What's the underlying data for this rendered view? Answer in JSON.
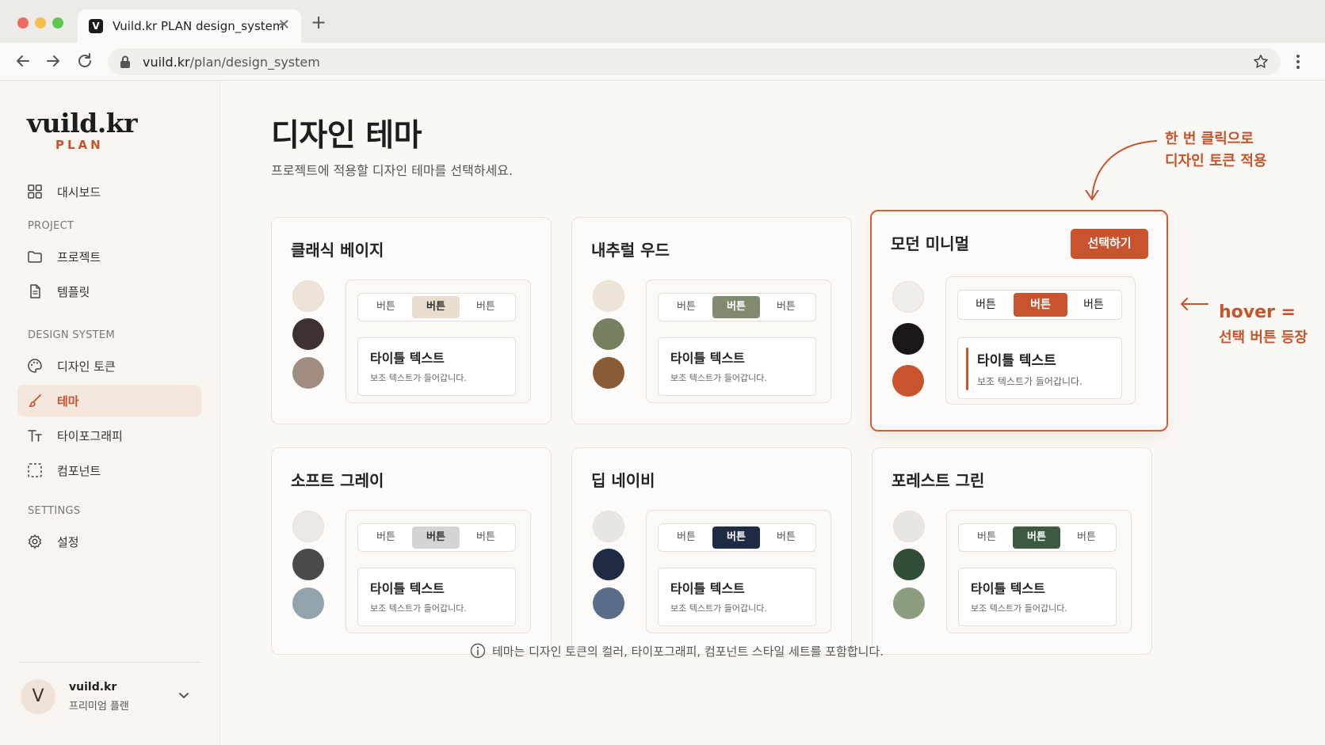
{
  "browser": {
    "tab_title": "Vuild.kr PLAN design_system",
    "favicon": "V",
    "url_domain": "vuild.kr",
    "url_path": "/plan/design_system"
  },
  "sidebar": {
    "logo": "vuild.kr",
    "logo_sub": "PLAN",
    "dashboard": "대시보드",
    "sections": {
      "project": "PROJECT",
      "design_system": "DESIGN SYSTEM",
      "settings": "SETTINGS"
    },
    "items": {
      "project": "프로젝트",
      "template": "템플릿",
      "design_token": "디자인 토큰",
      "theme": "테마",
      "typography": "타이포그래피",
      "component": "컴포넌트",
      "settings": "설정"
    },
    "user": {
      "initial": "V",
      "name": "vuild.kr",
      "plan": "프리미엄 플랜"
    }
  },
  "main": {
    "title": "디자인 테마",
    "subtitle": "프로젝트에 적용할 디자인 테마를 선택하세요.",
    "select_button": "선택하기",
    "button_label": "버튼",
    "preview_title": "타이틀 텍스트",
    "preview_sub": "보조 텍스트가 들어갑니다.",
    "footer_note": "테마는 디자인 토큰의 컬러, 타이포그래피, 컴포넌트 스타일 세트를 포함합니다."
  },
  "themes": [
    {
      "name": "클래식 베이지",
      "colors": [
        "#ede3d8",
        "#3e3230",
        "#a08d80"
      ],
      "active_bg": "#e9ddd0",
      "active_fg": "#333333",
      "selected": false
    },
    {
      "name": "내추럴 우드",
      "colors": [
        "#ede3d8",
        "#77805f",
        "#8a5a34"
      ],
      "active_bg": "#808a6c",
      "active_fg": "#ffffff",
      "selected": false
    },
    {
      "name": "모던 미니멀",
      "colors": [
        "#f1efec",
        "#1a1716",
        "#c9532c"
      ],
      "active_bg": "#c9532c",
      "active_fg": "#ffffff",
      "selected": true
    },
    {
      "name": "소프트 그레이",
      "colors": [
        "#ebe8e5",
        "#4a4a4a",
        "#93a3ad"
      ],
      "active_bg": "#d6d4d2",
      "active_fg": "#333333",
      "selected": false
    },
    {
      "name": "딥 네이비",
      "colors": [
        "#e8e6e3",
        "#1f2b45",
        "#5a6c8a"
      ],
      "active_bg": "#1f2b45",
      "active_fg": "#ffffff",
      "selected": false
    },
    {
      "name": "포레스트 그린",
      "colors": [
        "#e8e6e1",
        "#304d38",
        "#8c9d80"
      ],
      "active_bg": "#3d5a40",
      "active_fg": "#ffffff",
      "selected": false
    }
  ],
  "annotations": {
    "click_line1": "한 번 클릭으로",
    "click_line2": "디자인 토큰 적용",
    "hover_line1": "hover =",
    "hover_line2": "선택 버튼 등장"
  },
  "colors": {
    "accent": "#c4542c"
  }
}
